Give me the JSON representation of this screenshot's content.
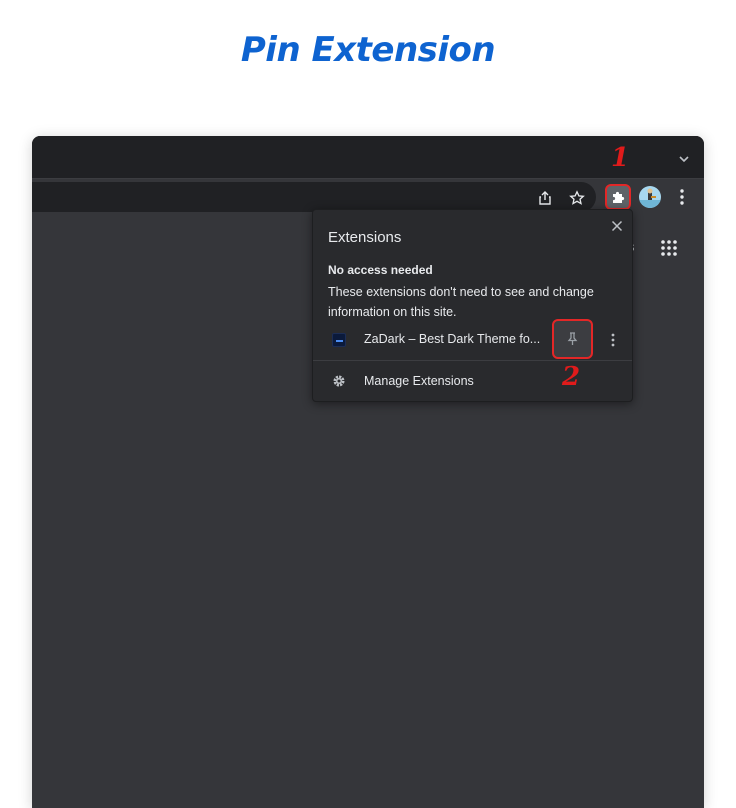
{
  "page": {
    "title": "Pin Extension"
  },
  "browser": {
    "content_peek_text": "s"
  },
  "annotations": {
    "step1": "1",
    "step2": "2"
  },
  "popup": {
    "title": "Extensions",
    "section_heading": "No access needed",
    "section_description": "These extensions don't need to see and change information on this site.",
    "extensions": [
      {
        "name": "ZaDark – Best Dark Theme fo..."
      }
    ],
    "manage_label": "Manage Extensions"
  },
  "icons": {
    "toolbar": [
      "share-icon",
      "star-icon",
      "extensions-puzzle-icon",
      "avatar",
      "more-vert-icon"
    ],
    "popup": [
      "close-icon",
      "pin-icon",
      "more-vert-icon",
      "gear-icon"
    ],
    "content": [
      "apps-grid-icon"
    ]
  },
  "colors": {
    "title": "#0e63d0",
    "annotation": "#e01b1b",
    "highlight_border": "#e32727",
    "browser_bg": "#35363a",
    "tabstrip_bg": "#202124",
    "popup_bg": "#292a2d"
  }
}
